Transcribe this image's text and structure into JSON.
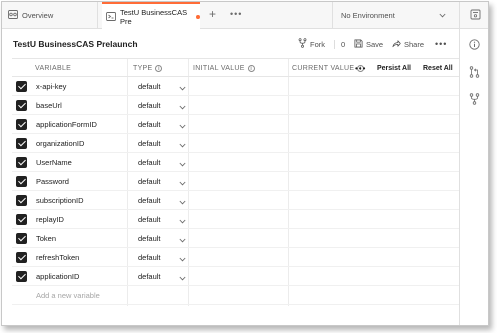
{
  "tabs": [
    {
      "label": "Overview",
      "icon": "overview-icon"
    },
    {
      "label": "TestU BusinessCAS Pre",
      "icon": "environment-icon",
      "unsaved": true
    }
  ],
  "new_tab_label": "+",
  "tabs_more_label": "•••",
  "environment_selector": {
    "value": "No Environment"
  },
  "header": {
    "title": "TestU BusinessCAS Prelaunch",
    "fork_label": "Fork",
    "fork_count": "0",
    "save_label": "Save",
    "share_label": "Share",
    "more_label": "•••"
  },
  "columns": {
    "variable": "VARIABLE",
    "type": "TYPE",
    "initial_value": "INITIAL VALUE",
    "current_value": "CURRENT VALUE",
    "more": "•••",
    "persist_all": "Persist All",
    "reset_all": "Reset All"
  },
  "rows": [
    {
      "variable": "x-api-key",
      "type": "default",
      "checked": true
    },
    {
      "variable": "baseUrl",
      "type": "default",
      "checked": true
    },
    {
      "variable": "applicationFormID",
      "type": "default",
      "checked": true
    },
    {
      "variable": "organizationID",
      "type": "default",
      "checked": true
    },
    {
      "variable": "UserName",
      "type": "default",
      "checked": true
    },
    {
      "variable": "Password",
      "type": "default",
      "checked": true
    },
    {
      "variable": "subscriptionID",
      "type": "default",
      "checked": true
    },
    {
      "variable": "replayID",
      "type": "default",
      "checked": true
    },
    {
      "variable": "Token",
      "type": "default",
      "checked": true
    },
    {
      "variable": "refreshToken",
      "type": "default",
      "checked": true
    },
    {
      "variable": "applicationID",
      "type": "default",
      "checked": true
    }
  ],
  "add_variable_placeholder": "Add a new variable",
  "right_sidebar": [
    "environment-quick-look-icon",
    "info-icon",
    "pull-request-icon",
    "fork-icon"
  ],
  "colors": {
    "accent": "#ff6c37",
    "checkbox": "#212121"
  }
}
